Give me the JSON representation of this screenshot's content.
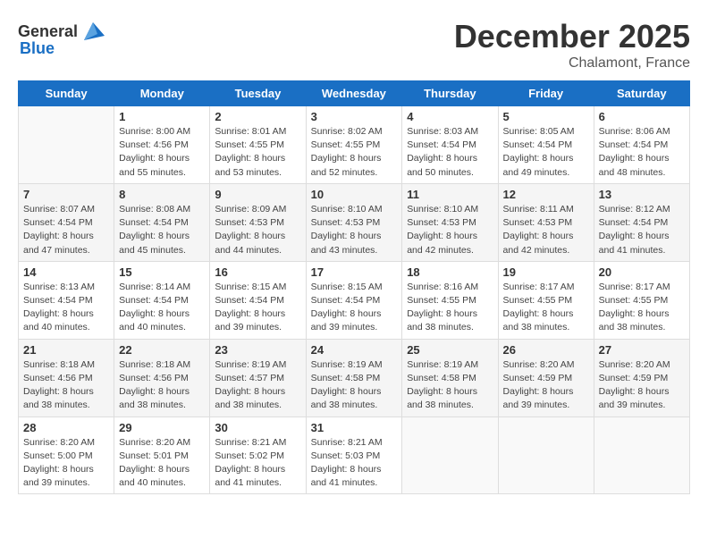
{
  "header": {
    "logo_general": "General",
    "logo_blue": "Blue",
    "month": "December 2025",
    "location": "Chalamont, France"
  },
  "days_of_week": [
    "Sunday",
    "Monday",
    "Tuesday",
    "Wednesday",
    "Thursday",
    "Friday",
    "Saturday"
  ],
  "weeks": [
    [
      {
        "day": "",
        "info": ""
      },
      {
        "day": "1",
        "info": "Sunrise: 8:00 AM\nSunset: 4:56 PM\nDaylight: 8 hours\nand 55 minutes."
      },
      {
        "day": "2",
        "info": "Sunrise: 8:01 AM\nSunset: 4:55 PM\nDaylight: 8 hours\nand 53 minutes."
      },
      {
        "day": "3",
        "info": "Sunrise: 8:02 AM\nSunset: 4:55 PM\nDaylight: 8 hours\nand 52 minutes."
      },
      {
        "day": "4",
        "info": "Sunrise: 8:03 AM\nSunset: 4:54 PM\nDaylight: 8 hours\nand 50 minutes."
      },
      {
        "day": "5",
        "info": "Sunrise: 8:05 AM\nSunset: 4:54 PM\nDaylight: 8 hours\nand 49 minutes."
      },
      {
        "day": "6",
        "info": "Sunrise: 8:06 AM\nSunset: 4:54 PM\nDaylight: 8 hours\nand 48 minutes."
      }
    ],
    [
      {
        "day": "7",
        "info": "Sunrise: 8:07 AM\nSunset: 4:54 PM\nDaylight: 8 hours\nand 47 minutes."
      },
      {
        "day": "8",
        "info": "Sunrise: 8:08 AM\nSunset: 4:54 PM\nDaylight: 8 hours\nand 45 minutes."
      },
      {
        "day": "9",
        "info": "Sunrise: 8:09 AM\nSunset: 4:53 PM\nDaylight: 8 hours\nand 44 minutes."
      },
      {
        "day": "10",
        "info": "Sunrise: 8:10 AM\nSunset: 4:53 PM\nDaylight: 8 hours\nand 43 minutes."
      },
      {
        "day": "11",
        "info": "Sunrise: 8:10 AM\nSunset: 4:53 PM\nDaylight: 8 hours\nand 42 minutes."
      },
      {
        "day": "12",
        "info": "Sunrise: 8:11 AM\nSunset: 4:53 PM\nDaylight: 8 hours\nand 42 minutes."
      },
      {
        "day": "13",
        "info": "Sunrise: 8:12 AM\nSunset: 4:54 PM\nDaylight: 8 hours\nand 41 minutes."
      }
    ],
    [
      {
        "day": "14",
        "info": "Sunrise: 8:13 AM\nSunset: 4:54 PM\nDaylight: 8 hours\nand 40 minutes."
      },
      {
        "day": "15",
        "info": "Sunrise: 8:14 AM\nSunset: 4:54 PM\nDaylight: 8 hours\nand 40 minutes."
      },
      {
        "day": "16",
        "info": "Sunrise: 8:15 AM\nSunset: 4:54 PM\nDaylight: 8 hours\nand 39 minutes."
      },
      {
        "day": "17",
        "info": "Sunrise: 8:15 AM\nSunset: 4:54 PM\nDaylight: 8 hours\nand 39 minutes."
      },
      {
        "day": "18",
        "info": "Sunrise: 8:16 AM\nSunset: 4:55 PM\nDaylight: 8 hours\nand 38 minutes."
      },
      {
        "day": "19",
        "info": "Sunrise: 8:17 AM\nSunset: 4:55 PM\nDaylight: 8 hours\nand 38 minutes."
      },
      {
        "day": "20",
        "info": "Sunrise: 8:17 AM\nSunset: 4:55 PM\nDaylight: 8 hours\nand 38 minutes."
      }
    ],
    [
      {
        "day": "21",
        "info": "Sunrise: 8:18 AM\nSunset: 4:56 PM\nDaylight: 8 hours\nand 38 minutes."
      },
      {
        "day": "22",
        "info": "Sunrise: 8:18 AM\nSunset: 4:56 PM\nDaylight: 8 hours\nand 38 minutes."
      },
      {
        "day": "23",
        "info": "Sunrise: 8:19 AM\nSunset: 4:57 PM\nDaylight: 8 hours\nand 38 minutes."
      },
      {
        "day": "24",
        "info": "Sunrise: 8:19 AM\nSunset: 4:58 PM\nDaylight: 8 hours\nand 38 minutes."
      },
      {
        "day": "25",
        "info": "Sunrise: 8:19 AM\nSunset: 4:58 PM\nDaylight: 8 hours\nand 38 minutes."
      },
      {
        "day": "26",
        "info": "Sunrise: 8:20 AM\nSunset: 4:59 PM\nDaylight: 8 hours\nand 39 minutes."
      },
      {
        "day": "27",
        "info": "Sunrise: 8:20 AM\nSunset: 4:59 PM\nDaylight: 8 hours\nand 39 minutes."
      }
    ],
    [
      {
        "day": "28",
        "info": "Sunrise: 8:20 AM\nSunset: 5:00 PM\nDaylight: 8 hours\nand 39 minutes."
      },
      {
        "day": "29",
        "info": "Sunrise: 8:20 AM\nSunset: 5:01 PM\nDaylight: 8 hours\nand 40 minutes."
      },
      {
        "day": "30",
        "info": "Sunrise: 8:21 AM\nSunset: 5:02 PM\nDaylight: 8 hours\nand 41 minutes."
      },
      {
        "day": "31",
        "info": "Sunrise: 8:21 AM\nSunset: 5:03 PM\nDaylight: 8 hours\nand 41 minutes."
      },
      {
        "day": "",
        "info": ""
      },
      {
        "day": "",
        "info": ""
      },
      {
        "day": "",
        "info": ""
      }
    ]
  ]
}
